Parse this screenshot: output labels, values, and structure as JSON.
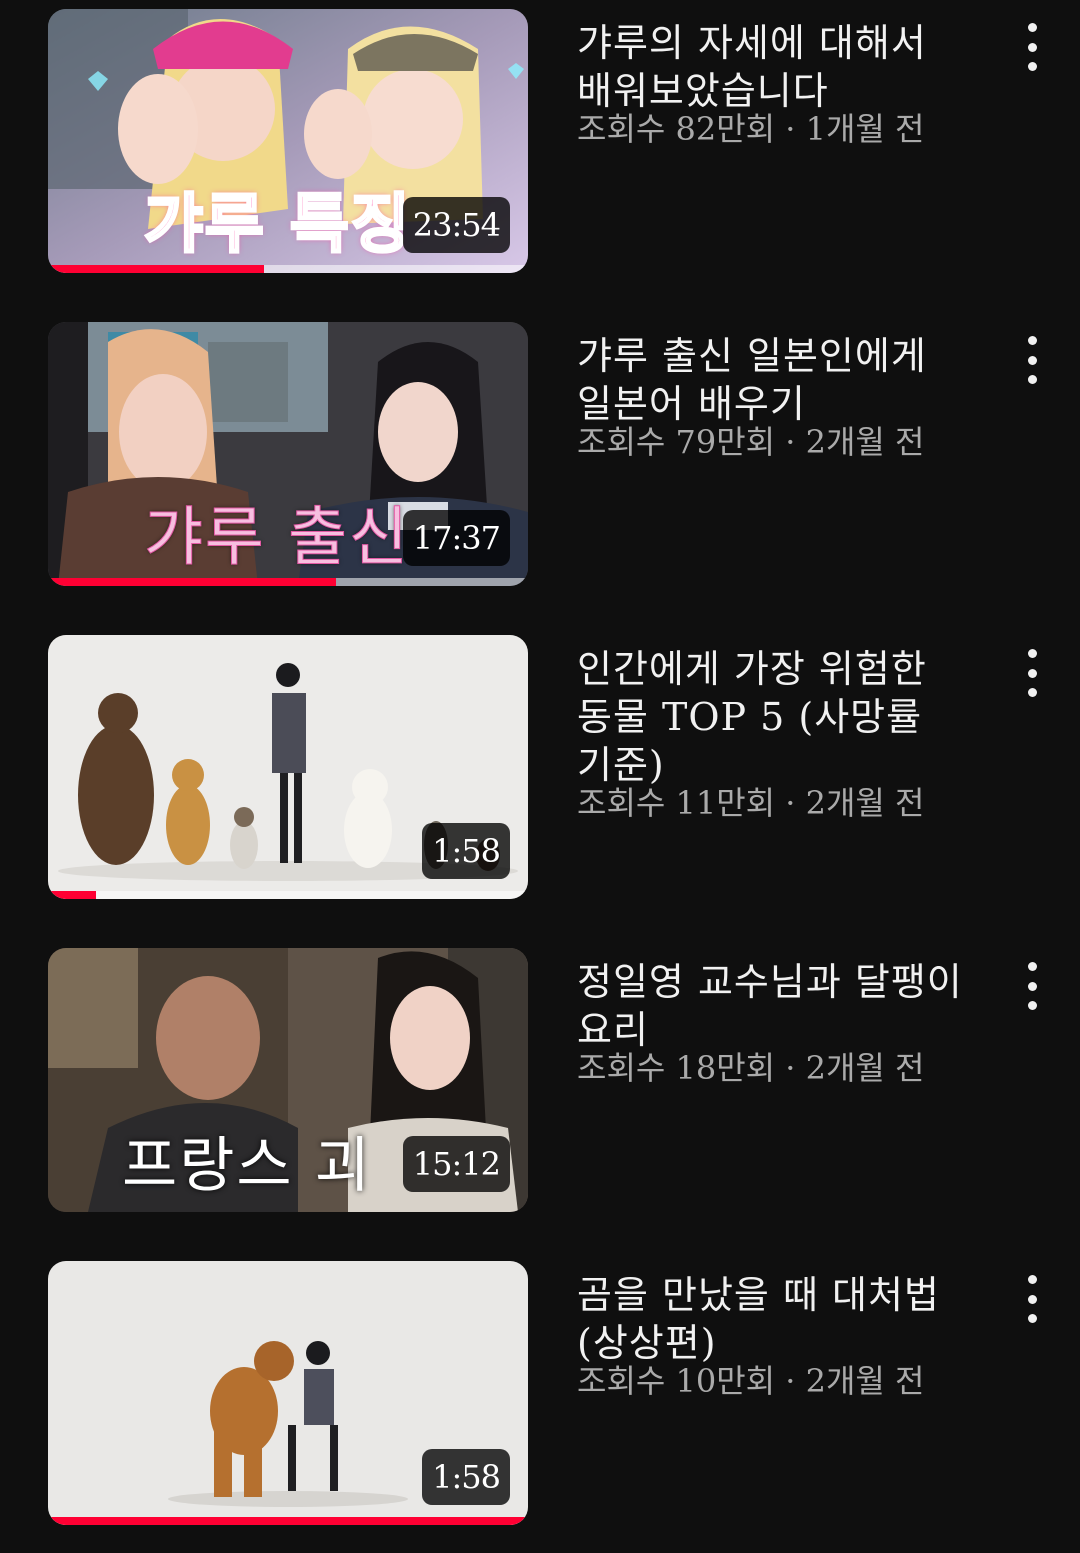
{
  "colors": {
    "background": "#0f0f0f",
    "title_text": "#f1f1f1",
    "meta_text": "#aaaaaa",
    "progress": "#ff0033"
  },
  "videos": [
    {
      "title_lines": [
        "갸루의 자세에 대해서",
        "배워보았습니다"
      ],
      "views": "조회수 82만회",
      "separator": "·",
      "age": "1개월 전",
      "duration": "23:54",
      "thumbnail_text": "갸루 특징",
      "watched_fraction": 0.45,
      "more_icon": "more-vert-icon"
    },
    {
      "title_lines": [
        "갸루 출신 일본인에게",
        "일본어 배우기"
      ],
      "views": "조회수 79만회",
      "separator": "·",
      "age": "2개월 전",
      "duration": "17:37",
      "thumbnail_text": "갸루 출신",
      "watched_fraction": 0.6,
      "more_icon": "more-vert-icon"
    },
    {
      "title_lines": [
        "인간에게 가장 위험한",
        "동물 TOP 5 (사망률",
        "기준)"
      ],
      "views": "조회수 11만회",
      "separator": "·",
      "age": "2개월 전",
      "duration": "1:58",
      "thumbnail_text": "",
      "watched_fraction": 0.1,
      "more_icon": "more-vert-icon"
    },
    {
      "title_lines": [
        "정일영 교수님과 달팽이",
        "요리"
      ],
      "views": "조회수 18만회",
      "separator": "·",
      "age": "2개월 전",
      "duration": "15:12",
      "thumbnail_text": "프랑스 괴",
      "watched_fraction": 0,
      "more_icon": "more-vert-icon"
    },
    {
      "title_lines": [
        "곰을 만났을 때 대처법",
        "(상상편)"
      ],
      "views": "조회수 10만회",
      "separator": "·",
      "age": "2개월 전",
      "duration": "1:58",
      "thumbnail_text": "",
      "watched_fraction": 1,
      "more_icon": "more-vert-icon"
    }
  ]
}
